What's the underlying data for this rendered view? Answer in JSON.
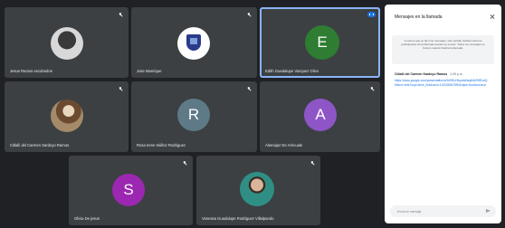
{
  "participants": [
    {
      "name": "Jesus Ramos escobedos",
      "avatar_letter": "",
      "avatar_color": "",
      "muted": true
    },
    {
      "name": "Jose Manrique",
      "avatar_letter": "",
      "avatar_color": "",
      "muted": true
    },
    {
      "name": "Edith Guadalupe Vazquez Olivo",
      "avatar_letter": "E",
      "avatar_color": "#2e7d32",
      "muted": false,
      "speaking": true
    },
    {
      "name": "Citlalli del Carmen Sardoyo Ramos",
      "avatar_letter": "",
      "avatar_color": "",
      "muted": true
    },
    {
      "name": "Rosa Irene Núñez Rodriguez",
      "avatar_letter": "R",
      "avatar_color": "#5f7a87",
      "muted": true
    },
    {
      "name": "Alemajaz De Arricuale",
      "avatar_letter": "A",
      "avatar_color": "#8e55c7",
      "muted": true
    },
    {
      "name": "Olivia De jesus",
      "avatar_letter": "S",
      "avatar_color": "#9c27b0",
      "muted": true
    },
    {
      "name": "Vanessa Guadalupe Rodriguez Villalpando",
      "avatar_letter": "",
      "avatar_color": "",
      "muted": true
    }
  ],
  "chat": {
    "title": "Mensajes en la llamada",
    "notice": "A menos que se fijen los mensajes, solo podrán visibles para los participantes de la llamada cuando se envían. Todos los mensajes se borran cuando finaliza la llamada.",
    "message": {
      "sender": "Citlalli del Carmen Sardoyo Ramos",
      "time": "1:09 p.m.",
      "text": "https://docs.google.com/presentation/d/1k9Rx2HqnaWwq8JbZ9fRzdQMsnm=rest?usp=drive_link&ouid=112034567890&rtpof=true&sd=true"
    },
    "input_placeholder": "Envía un mensaje"
  }
}
